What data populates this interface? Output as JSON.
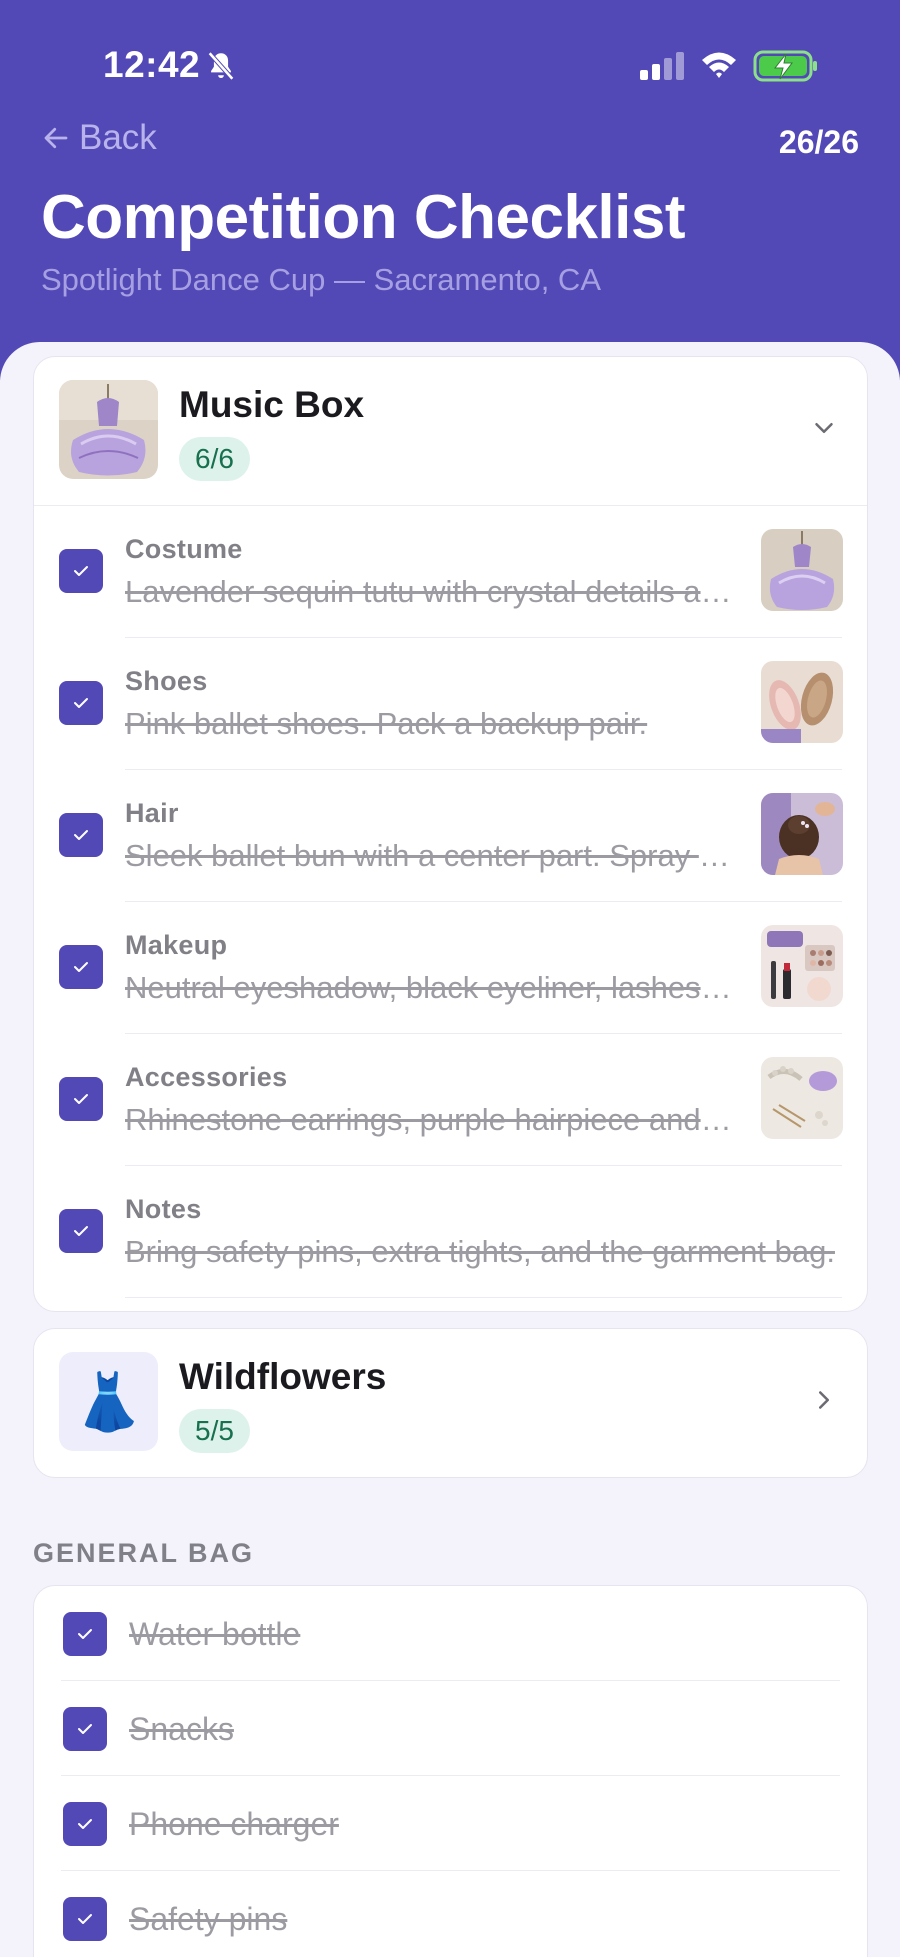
{
  "status_bar": {
    "time": "12:42"
  },
  "header": {
    "back_label": "Back",
    "progress": "26/26",
    "title": "Competition Checklist",
    "subtitle": "Spotlight Dance Cup — Sacramento, CA"
  },
  "routines": [
    {
      "name": "Music Box",
      "count": "6/6",
      "expanded": true,
      "items": [
        {
          "label": "Costume",
          "desc": "Lavender sequin tutu with crystal details and matching leotard.",
          "checked": true
        },
        {
          "label": "Shoes",
          "desc": "Pink ballet shoes. Pack a backup pair.",
          "checked": true
        },
        {
          "label": "Hair",
          "desc": "Sleek ballet bun with a center part. Spray and pin securely.",
          "checked": true
        },
        {
          "label": "Makeup",
          "desc": "Neutral eyeshadow, black eyeliner, lashes and red lipstick.",
          "checked": true
        },
        {
          "label": "Accessories",
          "desc": "Rhinestone earrings, purple hairpiece and hair pins.",
          "checked": true
        },
        {
          "label": "Notes",
          "desc": "Bring safety pins, extra tights, and the garment bag.",
          "checked": true
        }
      ]
    },
    {
      "name": "Wildflowers",
      "count": "5/5",
      "expanded": false,
      "emoji": "👗"
    }
  ],
  "general_bag": {
    "heading": "GENERAL BAG",
    "items": [
      {
        "label": "Water bottle",
        "checked": true
      },
      {
        "label": "Snacks",
        "checked": true
      },
      {
        "label": "Phone charger",
        "checked": true
      },
      {
        "label": "Safety pins",
        "checked": true
      }
    ]
  },
  "colors": {
    "header_bg": "#5249B6",
    "checkbox": "#5249B6",
    "pill_bg": "#DDF2EA",
    "pill_text": "#17704E",
    "page_bg": "#F4F3FB"
  }
}
